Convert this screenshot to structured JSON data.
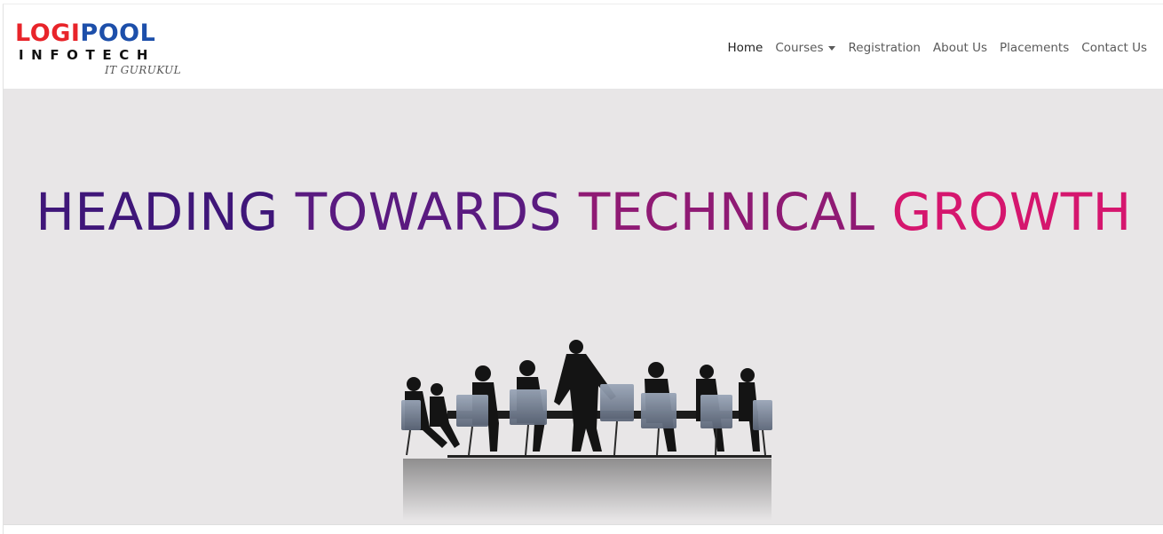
{
  "brand": {
    "part1": "LOGI",
    "part2": "POOL",
    "line2": "INFOTECH",
    "tagline": "IT GURUKUL",
    "colors": {
      "red": "#e8242a",
      "blue": "#1d4faa"
    }
  },
  "nav": {
    "items": [
      {
        "label": "Home",
        "active": true
      },
      {
        "label": "Courses",
        "dropdown": true
      },
      {
        "label": "Registration"
      },
      {
        "label": "About Us"
      },
      {
        "label": "Placements"
      },
      {
        "label": "Contact Us"
      }
    ]
  },
  "hero": {
    "title_words": [
      "HEADING",
      "TOWARDS",
      "TECHNICAL",
      "GROWTH"
    ],
    "gradient": [
      "#3f1679",
      "#5a1a80",
      "#8f1a74",
      "#d5166e"
    ],
    "background": "#e8e6e7",
    "image": "meeting-silhouette-illustration"
  }
}
